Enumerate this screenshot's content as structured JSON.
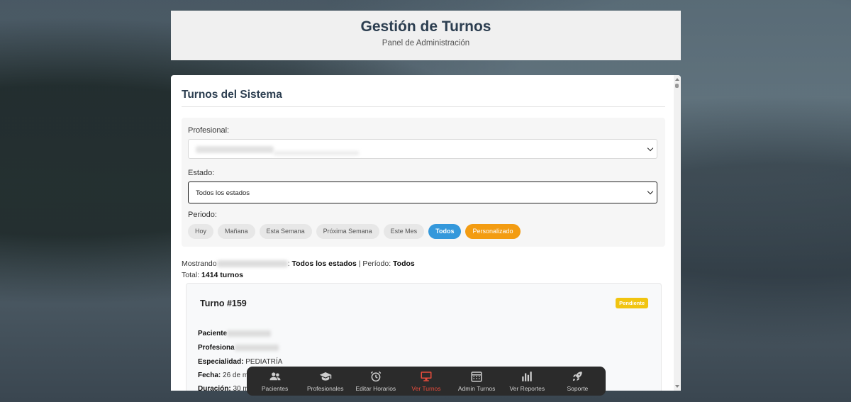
{
  "header": {
    "title": "Gestión de Turnos",
    "subtitle": "Panel de Administración"
  },
  "panel": {
    "title": "Turnos del Sistema",
    "filters": {
      "profesional_label": "Profesional:",
      "estado_label": "Estado:",
      "estado_value": "Todos los estados",
      "periodo_label": "Periodo:",
      "periods": [
        "Hoy",
        "Mañana",
        "Esta Semana",
        "Próxima Semana",
        "Este Mes",
        "Todos",
        "Personalizado"
      ],
      "active_period": "Todos"
    },
    "summary": {
      "mostrando": "Mostrando",
      "estado": "Todos los estados",
      "periodo_label": "Período:",
      "periodo": "Todos",
      "total_label": "Total:",
      "total": "1414 turnos"
    },
    "card": {
      "title": "Turno #159",
      "status": "Pendiente",
      "paciente_label": "Paciente",
      "profesional_label": "Profesiona",
      "especialidad_label": "Especialidad:",
      "especialidad": "PEDIATRÍA",
      "fecha_label": "Fecha:",
      "fecha": "26 de ma",
      "duracion_label": "Duración:",
      "duracion": "30 m"
    }
  },
  "dock": {
    "items": [
      {
        "label": "Pacientes",
        "icon": "users-icon"
      },
      {
        "label": "Profesionales",
        "icon": "graduation-cap-icon"
      },
      {
        "label": "Editar Horarios",
        "icon": "alarm-clock-icon"
      },
      {
        "label": "Ver Turnos",
        "icon": "monitor-icon"
      },
      {
        "label": "Admin Turnos",
        "icon": "calendar-icon"
      },
      {
        "label": "Ver Reportes",
        "icon": "bar-chart-icon"
      },
      {
        "label": "Soporte",
        "icon": "rocket-icon"
      }
    ],
    "active": "Ver Turnos"
  },
  "colors": {
    "accent": "#3498db",
    "custom": "#f39c12",
    "pending": "#f1c40f",
    "active_dock": "#e74c3c"
  }
}
